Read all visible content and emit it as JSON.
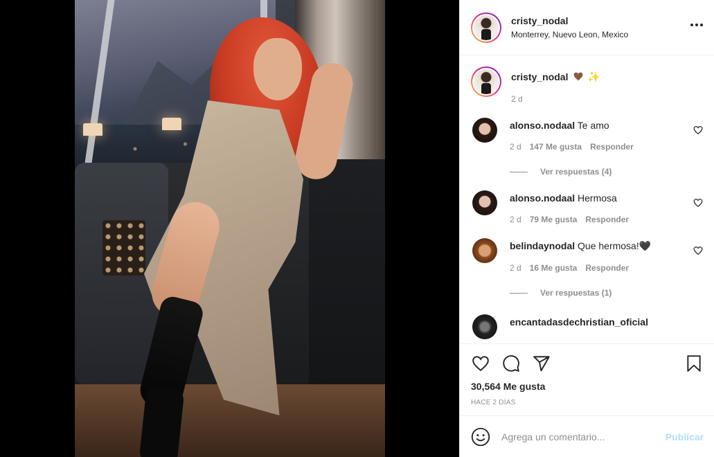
{
  "post": {
    "username": "cristy_nodal",
    "location": "Monterrey, Nuevo Leon, Mexico",
    "caption_time": "2 d",
    "likes": "30,564 Me gusta",
    "time_ago": "HACE 2 DÍAS"
  },
  "comments": [
    {
      "username": "alonso.nodaal",
      "text": "Te amo",
      "time": "2 d",
      "likes": "147 Me gusta",
      "reply_label": "Responder",
      "view_replies": "Ver respuestas (4)"
    },
    {
      "username": "alonso.nodaal",
      "text": "Hermosa",
      "time": "2 d",
      "likes": "79 Me gusta",
      "reply_label": "Responder"
    },
    {
      "username": "belindaynodal",
      "text": "Que hermosa!🖤",
      "time": "2 d",
      "likes": "16 Me gusta",
      "reply_label": "Responder",
      "view_replies": "Ver respuestas (1)"
    },
    {
      "username": "encantadasdechristian_oficial",
      "text": ""
    }
  ],
  "add_comment": {
    "placeholder": "Agrega un comentario...",
    "publish_label": "Publicar"
  },
  "colors": {
    "accent_disabled": "#b2dffc",
    "muted_text": "#8e8e8e",
    "primary_text": "#262626"
  }
}
